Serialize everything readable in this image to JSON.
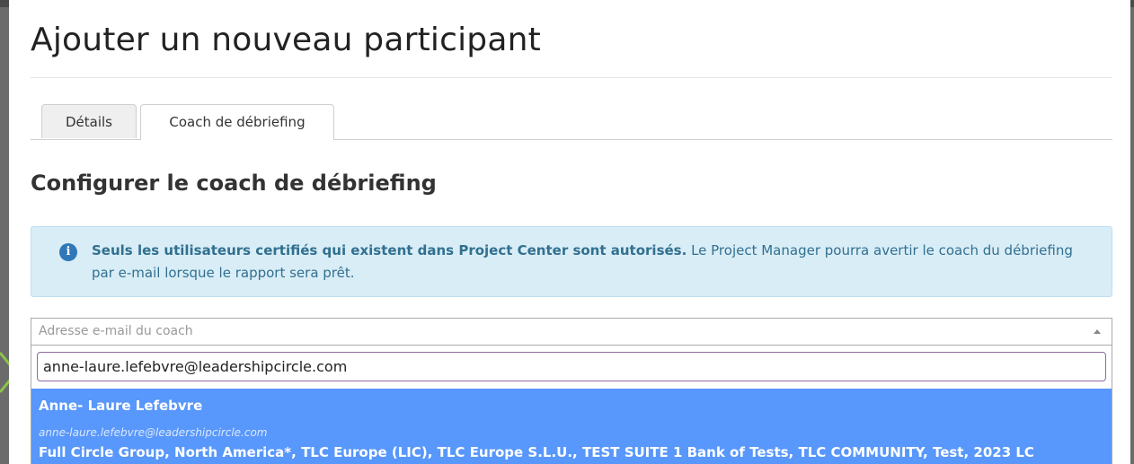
{
  "modal": {
    "title": "Ajouter un nouveau participant",
    "tabs": [
      {
        "label": "Détails",
        "active": false
      },
      {
        "label": "Coach de débriefing",
        "active": true
      }
    ],
    "section_heading": "Configurer le coach de débriefing",
    "alert": {
      "icon": "info-icon",
      "bold_text": "Seuls les utilisateurs certifiés qui existent dans Project Center sont autorisés.",
      "text": " Le Project Manager pourra avertir le coach du débriefing par e-mail lorsque le rapport sera prêt."
    },
    "coach_select": {
      "placeholder": "Adresse e-mail du coach",
      "search_value": "anne-laure.lefebvre@leadershipcircle.com",
      "highlighted_result": {
        "name": "Anne- Laure Lefebvre",
        "email": "anne-laure.lefebvre@leadershipcircle.com",
        "groups": "Full Circle Group, North America*, TLC Europe (LIC), TLC Europe S.L.U., TEST SUITE 1 Bank of Tests, TLC COMMUNITY, Test, 2023 LC"
      }
    }
  },
  "colors": {
    "alert_background": "#d9edf7",
    "alert_text": "#31708f",
    "highlight": "#5897fb",
    "search_border": "#8e6aa0"
  }
}
